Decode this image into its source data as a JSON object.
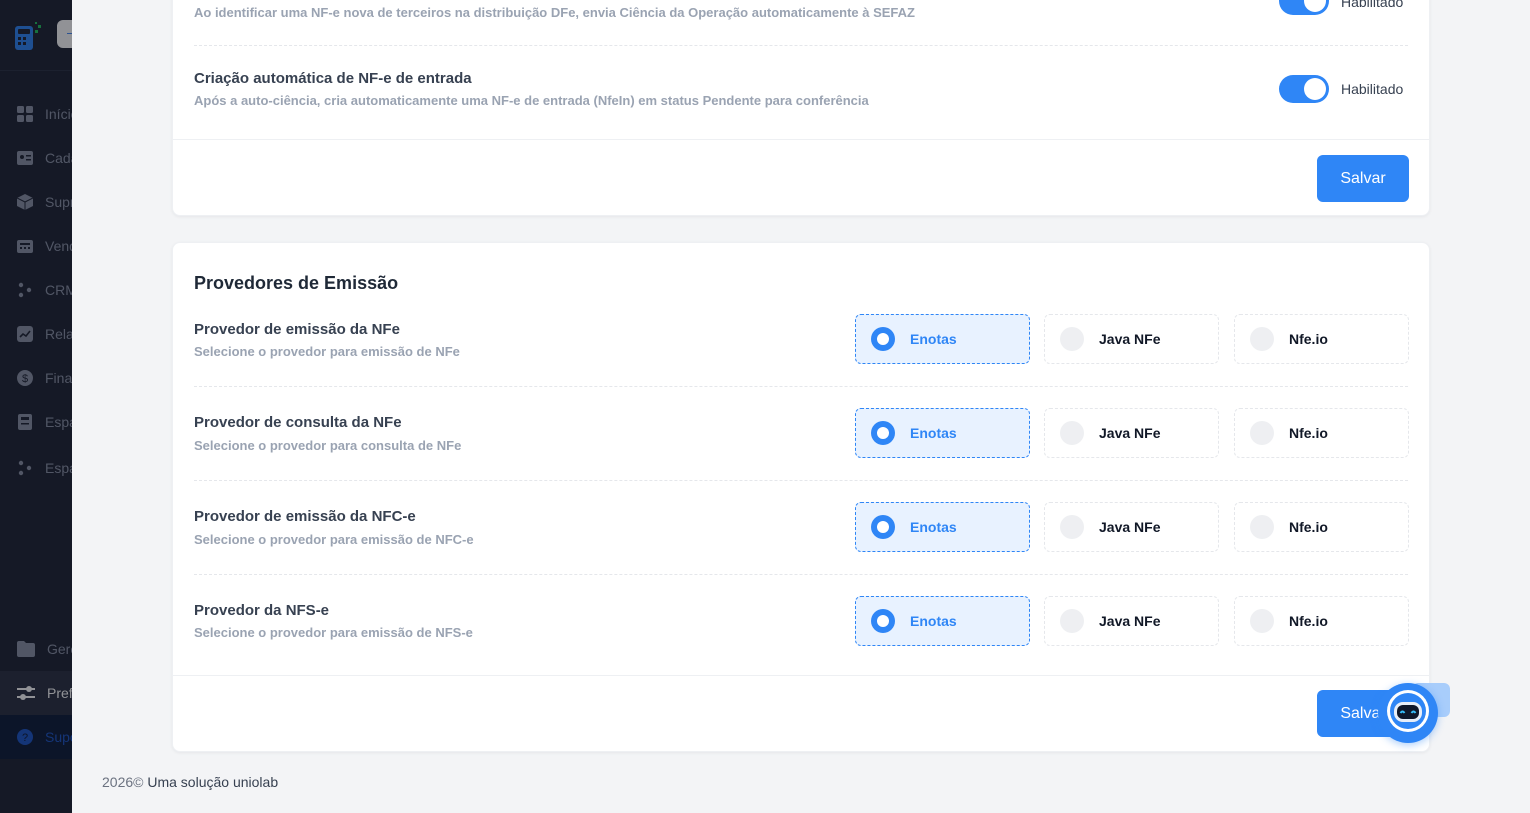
{
  "sidebar": {
    "logo_pill_label": "",
    "items": [
      {
        "label": "Início",
        "icon": "grid-icon"
      },
      {
        "label": "Cadastros",
        "icon": "id-card-icon"
      },
      {
        "label": "Suprimentos",
        "icon": "box-icon"
      },
      {
        "label": "Vendas",
        "icon": "cash-register-icon"
      },
      {
        "label": "CRM",
        "icon": "users-icon"
      },
      {
        "label": "Relatórios",
        "icon": "chart-icon"
      },
      {
        "label": "Financeiro",
        "icon": "dollar-icon"
      },
      {
        "label": "Espaços",
        "icon": "calculator-icon"
      },
      {
        "label": "Espaços",
        "icon": "people-icon"
      }
    ],
    "bottom_items": [
      {
        "label": "Gerenciador",
        "icon": "folder-icon"
      },
      {
        "label": "Preferências",
        "icon": "sliders-icon"
      },
      {
        "label": "Suporte",
        "icon": "help-icon"
      }
    ]
  },
  "dfe_card": {
    "auto_ciencia_sub": "Ao identificar uma NF-e nova de terceiros na distribuição DFe, envia Ciência da Operação automaticamente à SEFAZ",
    "auto_ciencia_status": "Habilitado",
    "auto_criacao_title": "Criação automática de NF-e de entrada",
    "auto_criacao_sub": "Após a auto-ciência, cria automaticamente uma NF-e de entrada (NfeIn) em status Pendente para conferência",
    "auto_criacao_status": "Habilitado",
    "save_label": "Salvar"
  },
  "providers_card": {
    "title": "Provedores de Emissão",
    "rows": [
      {
        "title": "Provedor de emissão da NFe",
        "subtitle": "Selecione o provedor para emissão de NFe",
        "selected": "Enotas"
      },
      {
        "title": "Provedor de consulta da NFe",
        "subtitle": "Selecione o provedor para consulta de NFe",
        "selected": "Enotas"
      },
      {
        "title": "Provedor de emissão da NFC-e",
        "subtitle": "Selecione o provedor para emissão de NFC-e",
        "selected": "Enotas"
      },
      {
        "title": "Provedor da NFS-e",
        "subtitle": "Selecione o provedor para emissão de NFS-e",
        "selected": "Enotas"
      }
    ],
    "options": [
      "Enotas",
      "Java NFe",
      "Nfe.io"
    ],
    "save_label": "Salvar"
  },
  "footer": {
    "year": "2026©",
    "text": "Uma solução uniolab"
  },
  "colors": {
    "accent": "#2f86f6",
    "sidebar_bg": "#1e2433",
    "page_bg": "#f3f4f6"
  }
}
